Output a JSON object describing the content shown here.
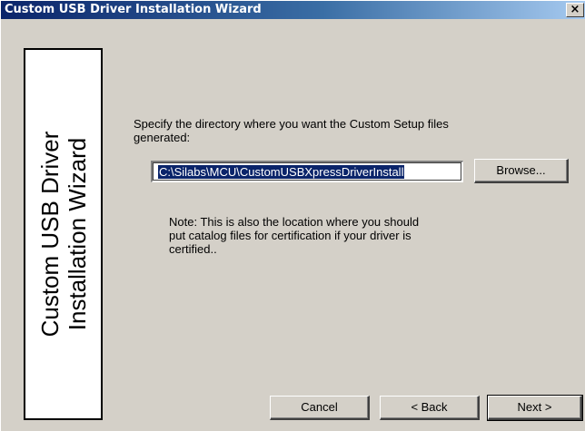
{
  "window": {
    "title": "Custom USB Driver Installation Wizard",
    "close_glyph": "✕"
  },
  "banner": {
    "line1": "Custom USB Driver",
    "line2": "Installation Wizard"
  },
  "main": {
    "instruction": "Specify the directory where you want the Custom Setup files generated:",
    "directory_value": "C:\\Silabs\\MCU\\CustomUSBXpressDriverInstall",
    "browse_label": "Browse...",
    "note": "Note: This is also the location where you should put catalog files for certification if your driver is certified.."
  },
  "footer": {
    "cancel_label": "Cancel",
    "back_label": "< Back",
    "next_label": "Next >"
  },
  "colors": {
    "titlebar_start": "#0a246a",
    "titlebar_end": "#a6caf0",
    "face": "#d4d0c8",
    "selection": "#0a246a"
  }
}
